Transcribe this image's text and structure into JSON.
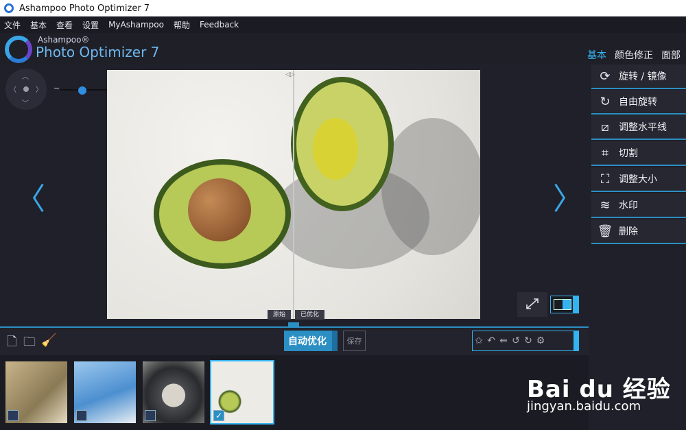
{
  "window": {
    "title": "Ashampoo Photo Optimizer 7"
  },
  "menu": [
    "文件",
    "基本",
    "查看",
    "设置",
    "MyAshampoo",
    "帮助",
    "Feedback"
  ],
  "brand": {
    "small": "Ashampoo®",
    "big": "Photo Optimizer 7"
  },
  "tabs": [
    {
      "label": "基本",
      "active": true
    },
    {
      "label": "颜色修正",
      "active": false
    },
    {
      "label": "面部",
      "active": false
    }
  ],
  "zoom": {
    "minus": "−",
    "plus": "+",
    "level": 0.3
  },
  "viewer": {
    "label_original": "原始",
    "label_optimized": "已优化"
  },
  "sidebar": {
    "items": [
      {
        "icon": "rotate-mirror-icon",
        "label": "旋转 / 镜像"
      },
      {
        "icon": "free-rotate-icon",
        "label": "自由旋转"
      },
      {
        "icon": "straighten-icon",
        "label": "调整水平线"
      },
      {
        "icon": "crop-icon",
        "label": "切割"
      },
      {
        "icon": "resize-icon",
        "label": "调整大小"
      },
      {
        "icon": "watermark-icon",
        "label": "水印"
      },
      {
        "icon": "trash-icon",
        "label": "删除"
      }
    ]
  },
  "toolbar": {
    "auto_optimize": "自动优化",
    "save": "保存",
    "rotate_left": "90°",
    "rotate_right": "90°"
  },
  "thumbnails": [
    {
      "name": "branch-bird",
      "checked": false
    },
    {
      "name": "sky-flower",
      "checked": false
    },
    {
      "name": "plates",
      "checked": false
    },
    {
      "name": "avocado",
      "checked": true
    }
  ],
  "watermark": {
    "line1": "Bai du 经验",
    "line2": "jingyan.baidu.com"
  },
  "colors": {
    "accent": "#35b3f0",
    "brand_blue": "#2b8fc4",
    "background": "#1e1f27"
  }
}
